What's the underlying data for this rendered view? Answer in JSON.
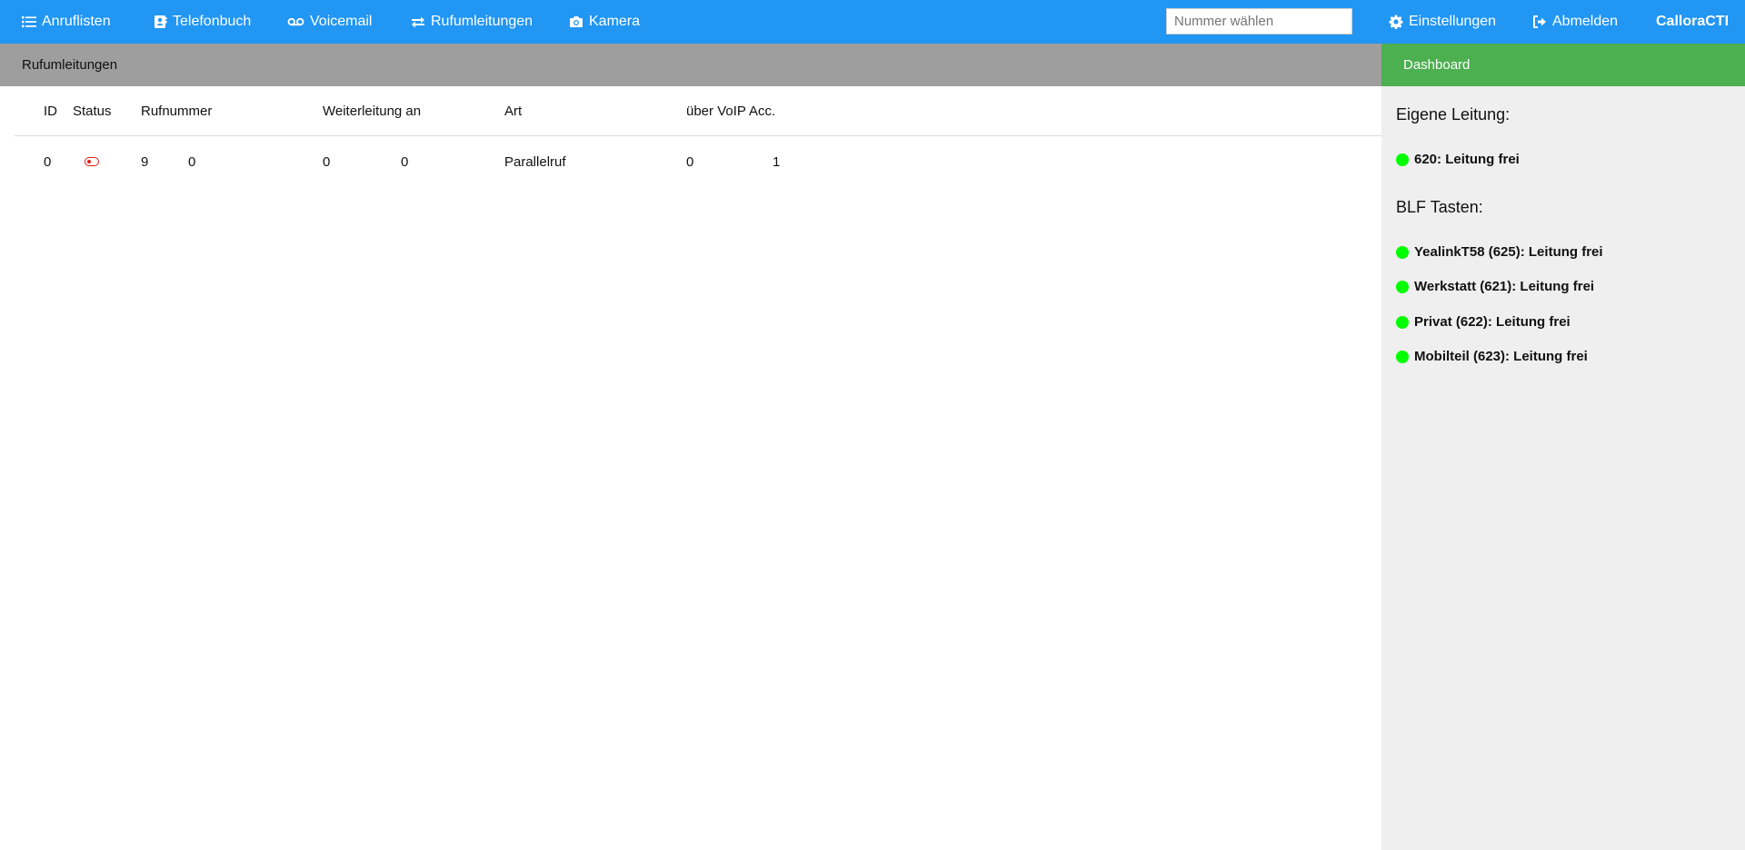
{
  "nav": {
    "items": [
      {
        "label": "Anruflisten",
        "icon": "list-icon"
      },
      {
        "label": "Telefonbuch",
        "icon": "contact-book-icon"
      },
      {
        "label": "Voicemail",
        "icon": "voicemail-icon"
      },
      {
        "label": "Rufumleitungen",
        "icon": "forward-arrows-icon"
      },
      {
        "label": "Kamera",
        "icon": "camera-icon"
      }
    ],
    "dial_placeholder": "Nummer wählen",
    "settings_label": "Einstellungen",
    "logout_label": "Abmelden",
    "brand": "CalloraCTI"
  },
  "main": {
    "title": "Rufumleitungen",
    "columns": [
      "ID",
      "Status",
      "Rufnummer",
      "Weiterleitung an",
      "Art",
      "über VoIP Acc."
    ],
    "rows": [
      {
        "id": "0",
        "status": "inactive",
        "rufnummer_a": "9",
        "rufnummer_b": "0",
        "weiterleitung_a": "0",
        "weiterleitung_b": "0",
        "art": "Parallelruf",
        "voip_a": "0",
        "voip_b": "1"
      }
    ]
  },
  "sidebar": {
    "tab_label": "Dashboard",
    "own_line_title": "Eigene Leitung:",
    "own_line": {
      "label": "620: Leitung frei",
      "status_color": "#00ff00"
    },
    "blf_title": "BLF Tasten:",
    "blf_items": [
      {
        "label": "YealinkT58 (625): Leitung frei"
      },
      {
        "label": "Werkstatt (621): Leitung frei"
      },
      {
        "label": "Privat (622): Leitung frei"
      },
      {
        "label": "Mobilteil (623): Leitung frei"
      }
    ]
  },
  "colors": {
    "topbar": "#2196f3",
    "header_gray": "#9e9e9e",
    "dashboard_green": "#4caf50",
    "status_free": "#00ff00",
    "toggle_off": "#e21b1b"
  }
}
